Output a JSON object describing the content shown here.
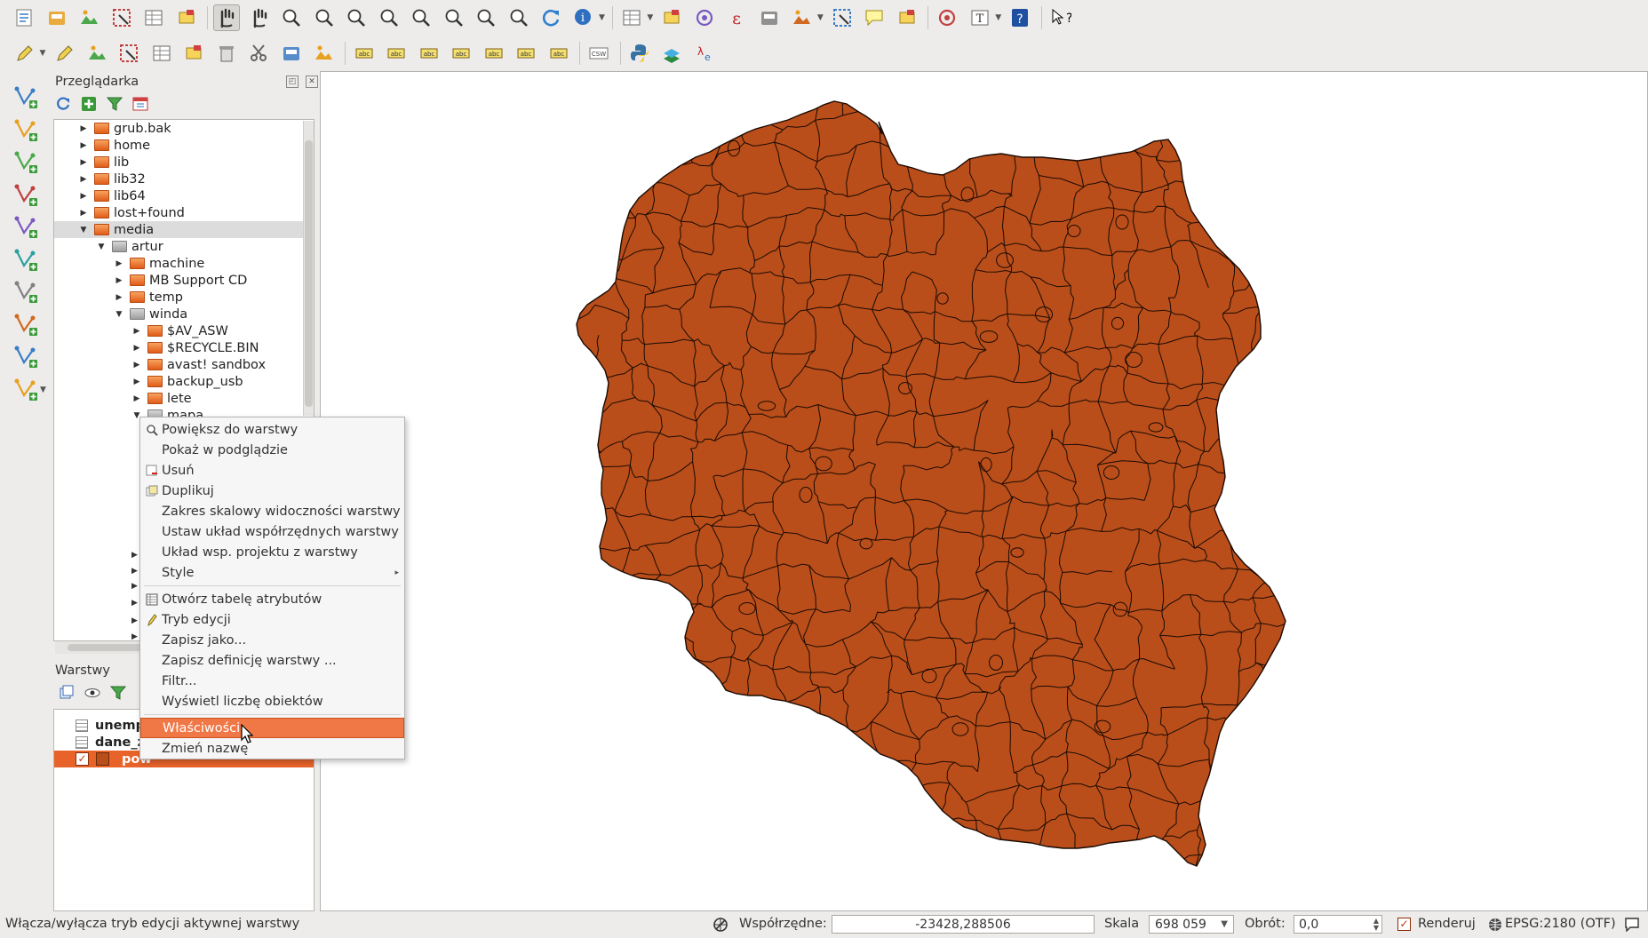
{
  "toolbar_top": [
    "new-project",
    "open-project",
    "save-project",
    "save-as",
    "new-print-composer",
    "composer-manager",
    "pan-map",
    "pan-to-selection",
    "zoom-in",
    "zoom-out",
    "zoom-native",
    "zoom-full",
    "zoom-to-selection",
    "zoom-to-layer",
    "zoom-last",
    "zoom-next",
    "refresh",
    "identify",
    "measure",
    "select-features",
    "deselect",
    "field-calculator",
    "attribute-table",
    "statistics",
    "measure-line",
    "annotation",
    "new-bookmark",
    "show-bookmarks",
    "text-annotation",
    "help",
    "whats-this"
  ],
  "toolbar_second": [
    "digitize",
    "toggle-editing",
    "save-edits",
    "add-feature",
    "move-feature",
    "node-tool",
    "delete-selected",
    "cut-features",
    "copy-features",
    "paste-features",
    "label-tool",
    "pin-labels",
    "show-hide-labels",
    "move-label",
    "rotate-label",
    "change-label",
    "label-properties",
    "csw",
    "python-console",
    "geoalgorithm",
    "layer-properties-info"
  ],
  "left_toolbar": [
    "add-vector-layer",
    "add-raster-layer",
    "add-postgis-layer",
    "add-spatialite-layer",
    "add-mssql-layer",
    "add-wms-layer",
    "add-wcs-layer",
    "add-wfs-layer",
    "add-delimited-text-layer",
    "new-shapefile-layer"
  ],
  "browser": {
    "title": "Przeglądarka",
    "items": [
      {
        "label": "grub.bak",
        "depth": 0,
        "expanded": false,
        "folder": "orange"
      },
      {
        "label": "home",
        "depth": 0,
        "expanded": false,
        "folder": "orange"
      },
      {
        "label": "lib",
        "depth": 0,
        "expanded": false,
        "folder": "orange"
      },
      {
        "label": "lib32",
        "depth": 0,
        "expanded": false,
        "folder": "orange"
      },
      {
        "label": "lib64",
        "depth": 0,
        "expanded": false,
        "folder": "orange"
      },
      {
        "label": "lost+found",
        "depth": 0,
        "expanded": false,
        "folder": "orange"
      },
      {
        "label": "media",
        "depth": 0,
        "expanded": true,
        "folder": "orange",
        "selected": true
      },
      {
        "label": "artur",
        "depth": 1,
        "expanded": true,
        "folder": "gray"
      },
      {
        "label": "machine",
        "depth": 2,
        "expanded": false,
        "folder": "orange"
      },
      {
        "label": "MB Support CD",
        "depth": 2,
        "expanded": false,
        "folder": "orange"
      },
      {
        "label": "temp",
        "depth": 2,
        "expanded": false,
        "folder": "orange"
      },
      {
        "label": "winda",
        "depth": 2,
        "expanded": true,
        "folder": "gray"
      },
      {
        "label": "$AV_ASW",
        "depth": 3,
        "expanded": false,
        "folder": "orange"
      },
      {
        "label": "$RECYCLE.BIN",
        "depth": 3,
        "expanded": false,
        "folder": "orange"
      },
      {
        "label": "avast! sandbox",
        "depth": 3,
        "expanded": false,
        "folder": "orange"
      },
      {
        "label": "backup_usb",
        "depth": 3,
        "expanded": false,
        "folder": "orange"
      },
      {
        "label": "lete",
        "depth": 3,
        "expanded": false,
        "folder": "orange"
      },
      {
        "label": "mapa",
        "depth": 3,
        "expanded": true,
        "folder": "gray"
      }
    ]
  },
  "layers_panel": {
    "title": "Warstwy",
    "items": [
      {
        "label": "unemp",
        "type": "table",
        "checked": false,
        "selected": false
      },
      {
        "label": "dane_z",
        "type": "table",
        "checked": false,
        "selected": false
      },
      {
        "label": "pow",
        "type": "polygon",
        "checked": true,
        "selected": true
      }
    ]
  },
  "context_menu": {
    "items": [
      {
        "label": "Powiększ do warstwy",
        "icon": "zoom-layer-icon"
      },
      {
        "label": "Pokaż w podglądzie",
        "icon": ""
      },
      {
        "label": "Usuń",
        "icon": "remove-layer-icon"
      },
      {
        "label": "Duplikuj",
        "icon": "duplicate-layer-icon"
      },
      {
        "label": "Zakres skalowy widoczności warstwy",
        "icon": ""
      },
      {
        "label": "Ustaw układ współrzędnych warstwy",
        "icon": ""
      },
      {
        "label": "Układ wsp. projektu z warstwy",
        "icon": ""
      },
      {
        "label": "Style",
        "icon": "",
        "submenu": true
      },
      {
        "separator": true
      },
      {
        "label": "Otwórz tabelę atrybutów",
        "icon": "attribute-table-icon"
      },
      {
        "label": "Tryb edycji",
        "icon": "pencil-icon"
      },
      {
        "label": "Zapisz jako...",
        "icon": ""
      },
      {
        "label": "Zapisz definicję warstwy ...",
        "icon": ""
      },
      {
        "label": "Filtr...",
        "icon": ""
      },
      {
        "label": "Wyświetl liczbę obiektów",
        "icon": ""
      },
      {
        "separator": true
      },
      {
        "label": "Właściwości",
        "icon": "",
        "highlighted": true
      },
      {
        "label": "Zmień nazwę",
        "icon": ""
      }
    ]
  },
  "map": {
    "fill_color": "#b94e1a",
    "stroke_color": "#1a0a03",
    "background": "#ffffff"
  },
  "statusbar": {
    "message": "Włącza/wyłącza tryb edycji aktywnej warstwy",
    "coords_label": "Współrzędne:",
    "coords_value": "-23428,288506",
    "scale_label": "Skala",
    "scale_value": "698 059",
    "rotation_label": "Obrót:",
    "rotation_value": "0,0",
    "render_label": "Renderuj",
    "render_checked": true,
    "crs_label": "EPSG:2180 (OTF)"
  }
}
